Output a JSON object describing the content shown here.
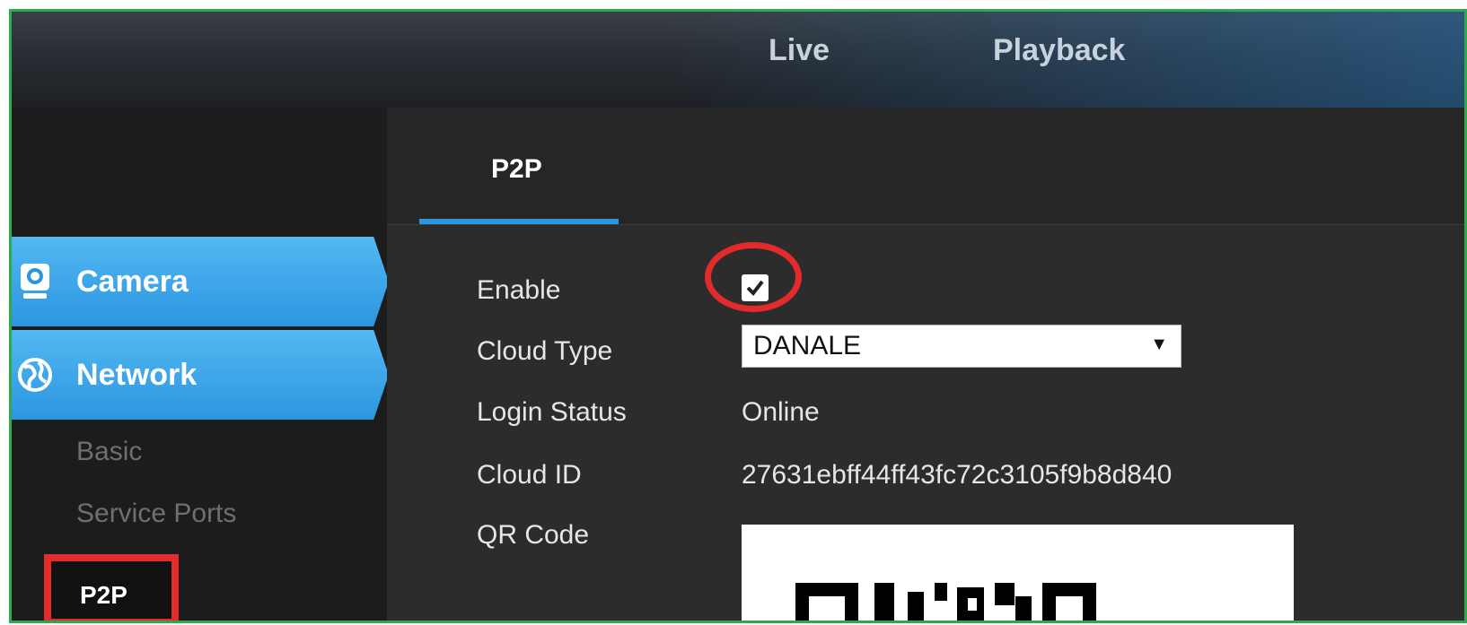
{
  "topnav": {
    "live": "Live",
    "playback": "Playback"
  },
  "sidebar": {
    "menus": [
      {
        "label": "Camera",
        "icon": "camera-icon"
      },
      {
        "label": "Network",
        "icon": "network-globe-icon"
      }
    ],
    "network_items": [
      "Basic",
      "Service Ports",
      "P2P"
    ],
    "selected_item": "P2P"
  },
  "main": {
    "tab": "P2P",
    "fields": {
      "enable_label": "Enable",
      "enable_checked": true,
      "cloud_type_label": "Cloud Type",
      "cloud_type_value": "DANALE",
      "login_status_label": "Login Status",
      "login_status_value": "Online",
      "cloud_id_label": "Cloud ID",
      "cloud_id_value": "27631ebff44ff43fc72c3105f9b8d840",
      "qr_code_label": "QR Code"
    }
  },
  "colors": {
    "accent_blue": "#2b96e0",
    "highlight_red": "#e32b2b",
    "frame_green": "#2fa84f"
  }
}
